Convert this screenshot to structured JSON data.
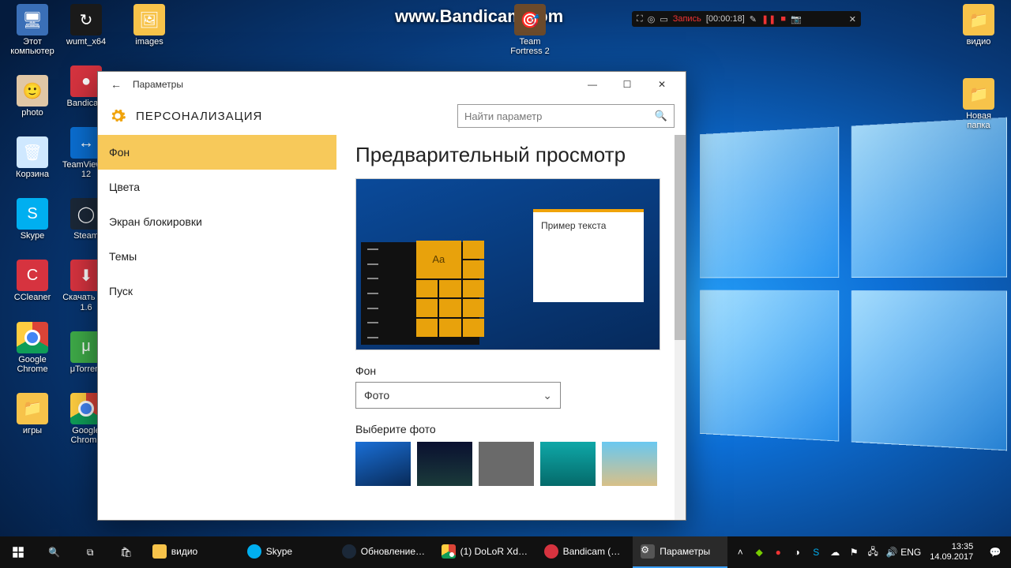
{
  "watermark": "www.Bandicam.com",
  "bandicam_bar": {
    "status": "Запись",
    "time": "[00:00:18]"
  },
  "desktop_icons": {
    "col1": [
      "Этот компьютер",
      "photo",
      "Корзина",
      "Skype",
      "CCleaner",
      "Google Chrome",
      "игры"
    ],
    "col2": [
      "wumt_x64",
      "Bandicam",
      "TeamViewer 12",
      "Steam",
      "Скачать CS 1.6",
      "μTorrent",
      "Google Chrome"
    ],
    "col3": [
      "images"
    ],
    "center": "Team Fortress 2",
    "right": [
      "видио",
      "Новая папка"
    ]
  },
  "settings": {
    "title": "Параметры",
    "category": "ПЕРСОНАЛИЗАЦИЯ",
    "search_placeholder": "Найти параметр",
    "nav": [
      "Фон",
      "Цвета",
      "Экран блокировки",
      "Темы",
      "Пуск"
    ],
    "nav_active": 0,
    "content": {
      "heading": "Предварительный просмотр",
      "sample_text": "Пример текста",
      "tile_aa": "Aa",
      "bg_label": "Фон",
      "bg_value": "Фото",
      "choose_label": "Выберите фото"
    }
  },
  "taskbar": {
    "tasks": [
      {
        "label": "видио",
        "color": "#f7c34a"
      },
      {
        "label": "Skype",
        "color": "#00aff0"
      },
      {
        "label": "Обновление ...",
        "color": "#1b2838"
      },
      {
        "label": "(1) DoLoR Xd ...",
        "color": "#4285f4"
      },
      {
        "label": "Bandicam (H...",
        "color": "#d6333f"
      },
      {
        "label": "Параметры",
        "color": "#555",
        "active": true
      }
    ],
    "lang": "ENG",
    "time": "13:35",
    "date": "14.09.2017"
  }
}
